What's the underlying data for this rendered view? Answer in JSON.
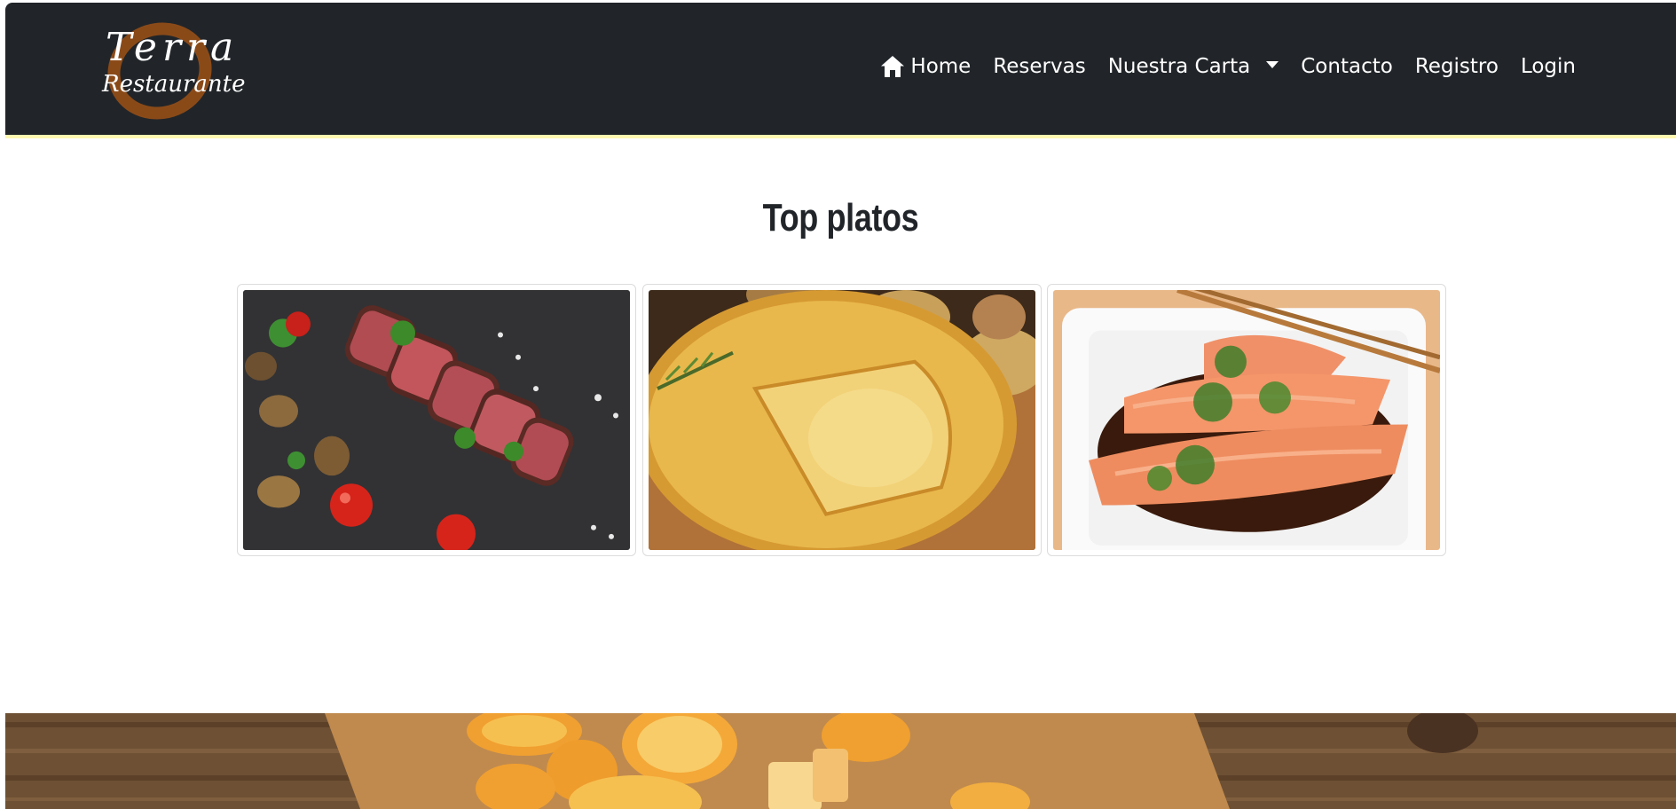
{
  "navbar": {
    "logo": {
      "line1": "Terra",
      "line2": "Restaurante"
    },
    "links": [
      {
        "label": "Home",
        "icon": "home-icon"
      },
      {
        "label": "Reservas"
      },
      {
        "label": "Nuestra Carta",
        "icon": "caret-down-icon"
      },
      {
        "label": "Contacto"
      },
      {
        "label": "Registro"
      },
      {
        "label": "Login"
      }
    ]
  },
  "main": {
    "title": "Top platos",
    "dishes": [
      {
        "image": "sliced-steak-photo"
      },
      {
        "image": "spanish-omelette-photo"
      },
      {
        "image": "salmon-fillets-photo"
      }
    ]
  },
  "colors": {
    "navbar_bg": "#212529",
    "navbar_border": "#fff8b0",
    "logo_ring": "#8a4a18",
    "text_dark": "#212529",
    "nav_text": "#ffffff"
  }
}
